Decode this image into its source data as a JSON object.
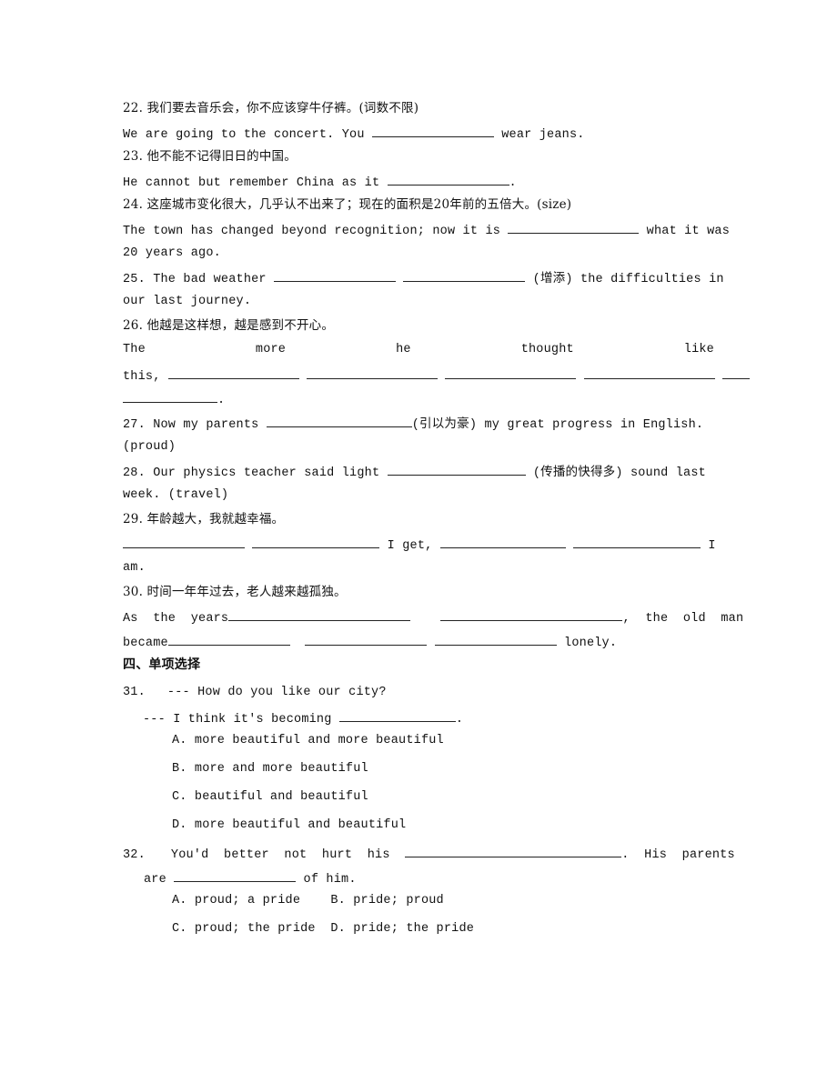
{
  "q22": {
    "prompt": "22. 我们要去音乐会，你不应该穿牛仔裤。(词数不限)",
    "before": "We are going to the concert. You ",
    "after": " wear jeans."
  },
  "q23": {
    "prompt": "23. 他不能不记得旧日的中国。",
    "before": "He cannot but remember China as it ",
    "after": "."
  },
  "q24": {
    "prompt": "24. 这座城市变化很大，几乎认不出来了；现在的面积是20年前的五倍大。(size)",
    "before": "The town has changed beyond recognition; now it is ",
    "after": " what it was",
    "line2": "20 years ago."
  },
  "q25": {
    "before": "25. The bad weather ",
    "after": " (增添) the difficulties in",
    "line2": "our last journey."
  },
  "q26": {
    "prompt": "26. 他越是这样想，越是感到不开心。",
    "words": [
      "The",
      "more",
      "he",
      "thought",
      "like"
    ],
    "line2_start": "this, ",
    "end": "."
  },
  "q27": {
    "before": "27. Now my parents ",
    "after": "(引以为豪) my great progress in English.",
    "line2": "(proud)"
  },
  "q28": {
    "before": "28. Our physics teacher said light ",
    "after": " (传播的快得多) sound last",
    "line2": "week. (travel)"
  },
  "q29": {
    "prompt": "29. 年龄越大，我就越幸福。",
    "middle": " I get, ",
    "end": " I",
    "line2": "am."
  },
  "q30": {
    "prompt": "30. 时间一年年过去，老人越来越孤独。",
    "before": "As  the  years",
    "after": ",  the  old  man",
    "line2_start": "became",
    "end": " lonely."
  },
  "section4": {
    "heading": "四、单项选择"
  },
  "q31": {
    "number": "31.",
    "question": "--- How do you like our city?",
    "answer_before": "--- I think it's becoming ",
    "answer_after": ".",
    "options": [
      "A. more beautiful and more beautiful",
      "B. more and more beautiful",
      "C. beautiful and beautiful",
      "D. more beautiful and beautiful"
    ]
  },
  "q32": {
    "number": "32.",
    "before": "You'd  better  not  hurt  his  ",
    "after": ".  His  parents",
    "line2_before": "are ",
    "line2_after": " of him.",
    "options_row1": "A. proud; a pride    B. pride; proud",
    "options_row2": "C. proud; the pride  D. pride; the pride"
  }
}
